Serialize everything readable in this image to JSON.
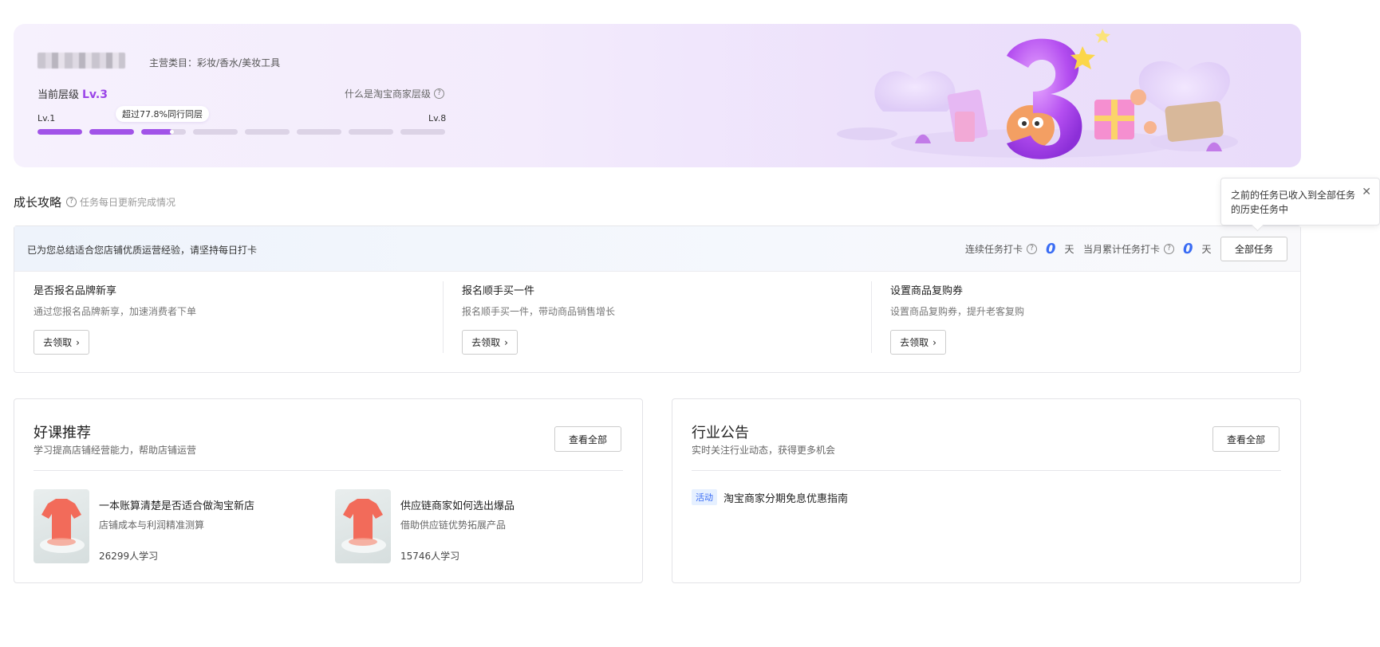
{
  "banner": {
    "category": "主营类目：彩妆/香水/美妆工具",
    "current_level_label": "当前层级",
    "current_level_value": "Lv.3",
    "what_is_level": "什么是淘宝商家层级",
    "lv_start": "Lv.1",
    "lv_end": "Lv.8",
    "peer_tip": "超过77.8%同行同层",
    "progress": {
      "segments": 8,
      "filled_fraction": 0.35
    }
  },
  "growth": {
    "title": "成长攻略",
    "subtitle": "任务每日更新完成情况",
    "hint": "已为您总结适合您店铺优质运营经验，请坚持每日打卡",
    "streak_label": "连续任务打卡",
    "streak_value": "0",
    "month_label": "当月累计任务打卡",
    "month_value": "0",
    "day_unit": "天",
    "all_tasks_button": "全部任务",
    "tasks": [
      {
        "title": "是否报名品牌新享",
        "desc": "通过您报名品牌新享，加速消费者下单",
        "button": "去领取"
      },
      {
        "title": "报名顺手买一件",
        "desc": "报名顺手买一件，带动商品销售增长",
        "button": "去领取"
      },
      {
        "title": "设置商品复购券",
        "desc": "设置商品复购券，提升老客复购",
        "button": "去领取"
      }
    ]
  },
  "popover": {
    "text": "之前的任务已收入到全部任务的历史任务中",
    "close_icon": "close-icon"
  },
  "courses": {
    "title": "好课推荐",
    "subtitle": "学习提高店铺经营能力，帮助店铺运营",
    "view_all": "查看全部",
    "items": [
      {
        "title": "一本账算清楚是否适合做淘宝新店",
        "desc": "店铺成本与利润精准测算",
        "count": "26299人学习"
      },
      {
        "title": "供应链商家如何选出爆品",
        "desc": "借助供应链优势拓展产品",
        "count": "15746人学习"
      }
    ]
  },
  "announcements": {
    "title": "行业公告",
    "subtitle": "实时关注行业动态，获得更多机会",
    "view_all": "查看全部",
    "items": [
      {
        "tag": "活动",
        "text": "淘宝商家分期免息优惠指南"
      }
    ]
  },
  "colors": {
    "accent_purple": "#a153e8",
    "accent_blue": "#3a6cf4"
  }
}
